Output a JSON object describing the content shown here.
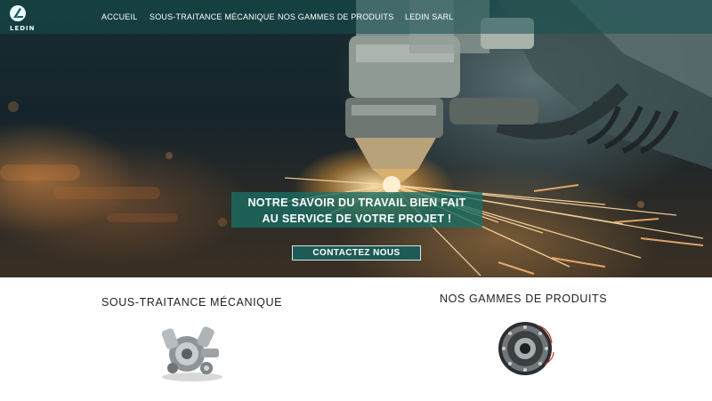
{
  "logo": {
    "text": "LEDIN",
    "icon": "ledin-logo"
  },
  "nav": {
    "items": [
      {
        "label": "ACCUEIL"
      },
      {
        "label": "SOUS-TRAITANCE MÉCANIQUE"
      },
      {
        "label": "NOS GAMMES DE PRODUITS"
      },
      {
        "label": "LEDIN SARL"
      }
    ]
  },
  "hero": {
    "tagline_line1": "NOTRE SAVOIR DU TRAVAIL BIEN FAIT",
    "tagline_line2": "AU SERVICE DE VOTRE PROJET !",
    "cta_label": "CONTACTEZ NOUS",
    "image": "laser-cutting-sparks"
  },
  "sections": [
    {
      "title": "SOUS-TRAITANCE MÉCANIQUE",
      "image": "engine-parts-icon"
    },
    {
      "title": "NOS GAMMES DE PRODUITS",
      "image": "gear-bearing-icon"
    }
  ],
  "colors": {
    "nav_bg": "#145050",
    "tagline_bg": "#1a6e64",
    "cta_bg": "#1f5b56"
  }
}
